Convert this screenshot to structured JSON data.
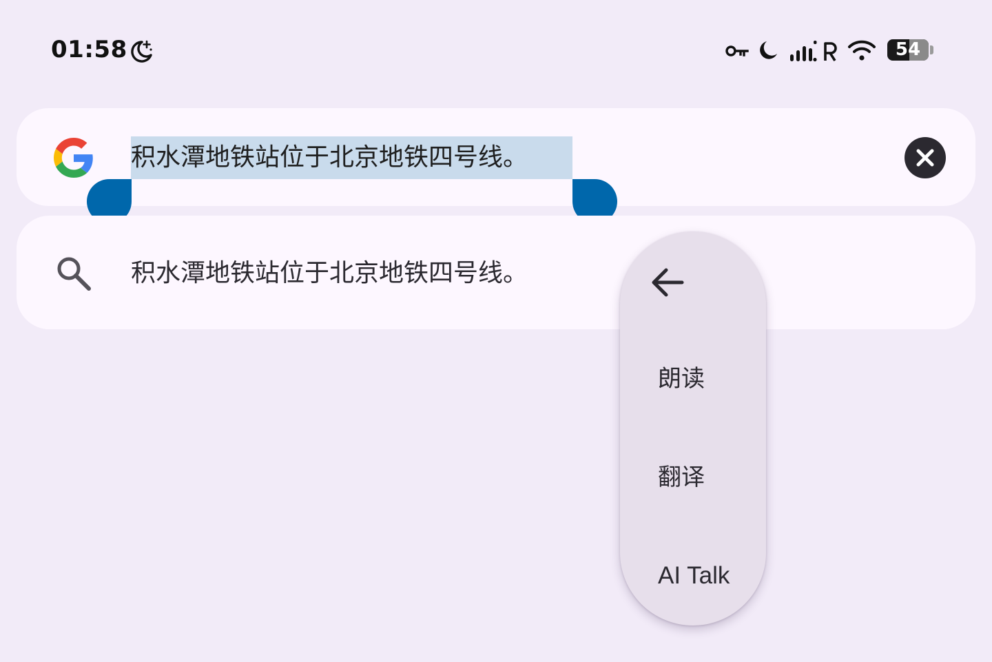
{
  "status_bar": {
    "time": "01:58",
    "battery_level": "54",
    "icons": [
      "do-not-disturb-moon-icon",
      "vpn-key-icon",
      "moon-icon",
      "signal-icon",
      "roaming-r-icon",
      "wifi-icon",
      "battery-icon"
    ]
  },
  "search": {
    "logo": "google-g-logo",
    "query": "积水潭地铁站位于北京地铁四号线。",
    "query_selected": true,
    "clear_icon": "close-circle-icon"
  },
  "suggestion": {
    "icon": "search-icon",
    "text": "积水潭地铁站位于北京地铁四号线。"
  },
  "text_selection_menu": {
    "back_icon": "arrow-left-icon",
    "items": [
      {
        "label": "朗读"
      },
      {
        "label": "翻译"
      },
      {
        "label": "AI Talk"
      }
    ]
  },
  "colors": {
    "background": "#f2ebf8",
    "card": "#fdf7ff",
    "selection_highlight": "#c9dbec",
    "selection_handle": "#0067ab",
    "menu_background": "#e7dfeb"
  }
}
